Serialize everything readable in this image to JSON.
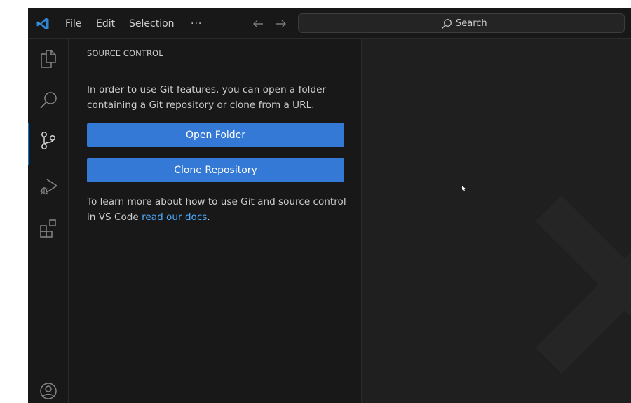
{
  "titlebar": {
    "logo_icon": "vscode-logo-icon",
    "menu": {
      "file": "File",
      "edit": "Edit",
      "selection": "Selection",
      "more": "···"
    },
    "search_label": "Search"
  },
  "activity_bar": {
    "items": [
      "explorer-icon",
      "search-icon",
      "source-control-icon",
      "run-debug-icon",
      "extensions-icon"
    ],
    "active": "source-control-icon",
    "account": "account-icon"
  },
  "sidebar": {
    "title": "SOURCE CONTROL",
    "intro_text": "In order to use Git features, you can open a folder containing a Git repository or clone from a URL.",
    "open_folder_label": "Open Folder",
    "clone_repository_label": "Clone Repository",
    "learn_prefix": "To learn more about how to use Git and source control in VS Code ",
    "learn_link": "read our docs",
    "learn_suffix": "."
  },
  "colors": {
    "accent": "#0078d4",
    "button": "#3479d6",
    "link": "#4daafc",
    "background": "#1f1f1f",
    "chrome": "#181818"
  }
}
